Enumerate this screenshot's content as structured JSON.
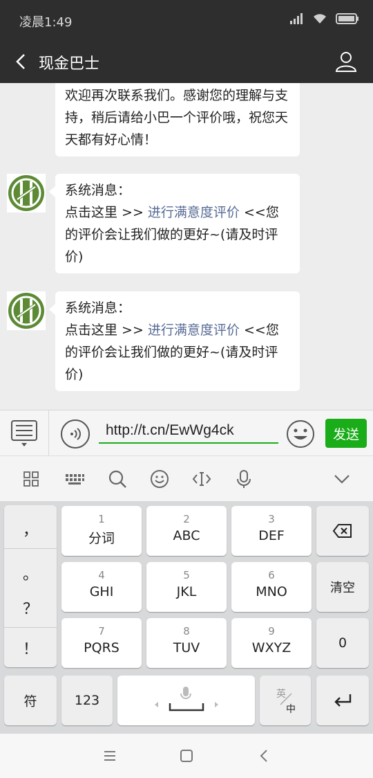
{
  "status_bar": {
    "time": "凌晨1:49"
  },
  "header": {
    "title": "现金巴士"
  },
  "messages": [
    {
      "text": "欢迎再次联系我们。感谢您的理解与支持，稍后请给小巴一个评价哦，祝您天天都有好心情！"
    },
    {
      "line1": "系统消息：",
      "prefix": "点击这里 >> ",
      "link": "进行满意度评价",
      "suffix": " <<您的评价会让我们做的更好~(请及时评价)"
    },
    {
      "line1": "系统消息：",
      "prefix": "点击这里 >> ",
      "link": "进行满意度评价",
      "suffix": " <<您的评价会让我们做的更好~(请及时评价)"
    }
  ],
  "input": {
    "value": "http://t.cn/EwWg4ck",
    "send_label": "发送"
  },
  "keyboard": {
    "punctuation": [
      "，",
      "。",
      "？",
      "！"
    ],
    "keys": [
      {
        "num": "1",
        "letters": "分词"
      },
      {
        "num": "2",
        "letters": "ABC"
      },
      {
        "num": "3",
        "letters": "DEF"
      },
      {
        "num": "4",
        "letters": "GHI"
      },
      {
        "num": "5",
        "letters": "JKL"
      },
      {
        "num": "6",
        "letters": "MNO"
      },
      {
        "num": "7",
        "letters": "PQRS"
      },
      {
        "num": "8",
        "letters": "TUV"
      },
      {
        "num": "9",
        "letters": "WXYZ"
      }
    ],
    "clear_label": "清空",
    "zero_label": "0",
    "symbol_label": "符",
    "num_label": "123",
    "lang_top": "英",
    "lang_bottom": "中"
  },
  "colors": {
    "accent": "#1aad19",
    "link": "#576b95",
    "header": "#2e2e2e"
  }
}
